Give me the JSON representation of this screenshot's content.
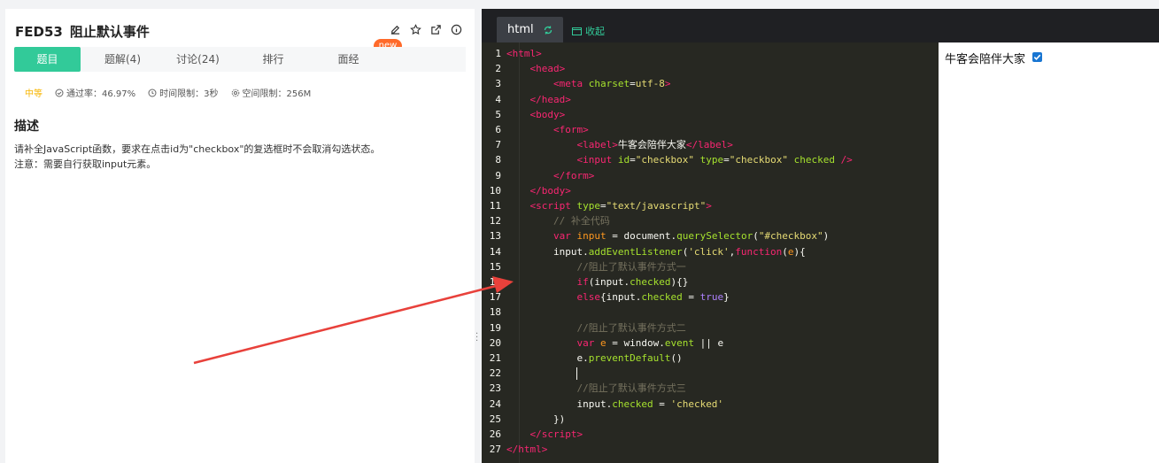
{
  "problem": {
    "id": "FED53",
    "title": "阻止默认事件",
    "new_badge": "new",
    "tabs": [
      {
        "label": "题目"
      },
      {
        "label": "题解(4)"
      },
      {
        "label": "讨论(24)"
      },
      {
        "label": "排行"
      },
      {
        "label": "面经"
      }
    ],
    "difficulty": "中等",
    "pass_rate": "通过率：46.97%",
    "time_limit": "时间限制：3秒",
    "space_limit": "空间限制：256M",
    "desc_title": "描述",
    "desc_line1": "请补全JavaScript函数，要求在点击id为\"checkbox\"的复选框时不会取消勾选状态。",
    "desc_line2": "注意：需要自行获取input元素。"
  },
  "editor": {
    "tab_label": "html",
    "collapse_label": "收起",
    "lines": [
      {
        "n": "1",
        "indent": "",
        "html": "<span class='tag'>&lt;html&gt;</span>"
      },
      {
        "n": "2",
        "indent": "    ",
        "html": "<span class='tag'>&lt;head&gt;</span>"
      },
      {
        "n": "3",
        "indent": "        ",
        "html": "<span class='tag'>&lt;meta</span> <span class='attr'>charset</span>=<span class='str'>utf-8</span><span class='tag'>&gt;</span>"
      },
      {
        "n": "4",
        "indent": "    ",
        "html": "<span class='tag'>&lt;/head&gt;</span>"
      },
      {
        "n": "5",
        "indent": "    ",
        "html": "<span class='tag'>&lt;body&gt;</span>"
      },
      {
        "n": "6",
        "indent": "        ",
        "html": "<span class='tag'>&lt;form&gt;</span>"
      },
      {
        "n": "7",
        "indent": "            ",
        "html": "<span class='tag'>&lt;label&gt;</span>牛客会陪伴大家<span class='tag'>&lt;/label&gt;</span>"
      },
      {
        "n": "8",
        "indent": "            ",
        "html": "<span class='tag'>&lt;input</span> <span class='attr'>id</span>=<span class='str'>\"checkbox\"</span> <span class='attr'>type</span>=<span class='str'>\"checkbox\"</span> <span class='attr'>checked</span> <span class='tag'>/&gt;</span>"
      },
      {
        "n": "9",
        "indent": "        ",
        "html": "<span class='tag'>&lt;/form&gt;</span>"
      },
      {
        "n": "10",
        "indent": "    ",
        "html": "<span class='tag'>&lt;/body&gt;</span>"
      },
      {
        "n": "11",
        "indent": "    ",
        "html": "<span class='tag'>&lt;script</span> <span class='attr'>type</span>=<span class='str'>\"text/javascript\"</span><span class='tag'>&gt;</span>"
      },
      {
        "n": "12",
        "indent": "        ",
        "html": "<span class='cmt'>// 补全代码</span>"
      },
      {
        "n": "13",
        "indent": "        ",
        "html": "<span class='kw'>var</span> <span class='param'>input</span> = document.<span class='fn'>querySelector</span>(<span class='str'>\"#checkbox\"</span>)"
      },
      {
        "n": "14",
        "indent": "        ",
        "html": "input.<span class='fn'>addEventListener</span>(<span class='str'>'click'</span>,<span class='kw'>function</span>(<span class='param'>e</span>){"
      },
      {
        "n": "15",
        "indent": "            ",
        "html": "<span class='cmt'>//阻止了默认事件方式一</span>"
      },
      {
        "n": "16",
        "indent": "            ",
        "html": "<span class='kw'>if</span>(input.<span class='prop'>checked</span>){}"
      },
      {
        "n": "17",
        "indent": "            ",
        "html": "<span class='kw'>else</span>{input.<span class='prop'>checked</span> = <span class='num'>true</span>}"
      },
      {
        "n": "18",
        "indent": "",
        "html": ""
      },
      {
        "n": "19",
        "indent": "            ",
        "html": "<span class='cmt'>//阻止了默认事件方式二</span>"
      },
      {
        "n": "20",
        "indent": "            ",
        "html": "<span class='kw'>var</span> <span class='param'>e</span> = window.<span class='prop'>event</span> || e"
      },
      {
        "n": "21",
        "indent": "            ",
        "html": "e.<span class='fn'>preventDefault</span>()"
      },
      {
        "n": "22",
        "indent": "            ",
        "html": "<span class='cursor'></span>"
      },
      {
        "n": "23",
        "indent": "            ",
        "html": "<span class='cmt'>//阻止了默认事件方式三</span>"
      },
      {
        "n": "24",
        "indent": "            ",
        "html": "input.<span class='prop'>checked</span> = <span class='str'>'checked'</span>"
      },
      {
        "n": "25",
        "indent": "        ",
        "html": "})"
      },
      {
        "n": "26",
        "indent": "    ",
        "html": "<span class='tag'>&lt;/script&gt;</span>"
      },
      {
        "n": "27",
        "indent": "",
        "html": "<span class='tag'>&lt;/html&gt;</span>"
      }
    ]
  },
  "preview": {
    "label": "牛客会陪伴大家",
    "checked": true
  },
  "colors": {
    "accent": "#32ca99",
    "badge": "#ff6a2a",
    "arrow": "#e8413b"
  }
}
